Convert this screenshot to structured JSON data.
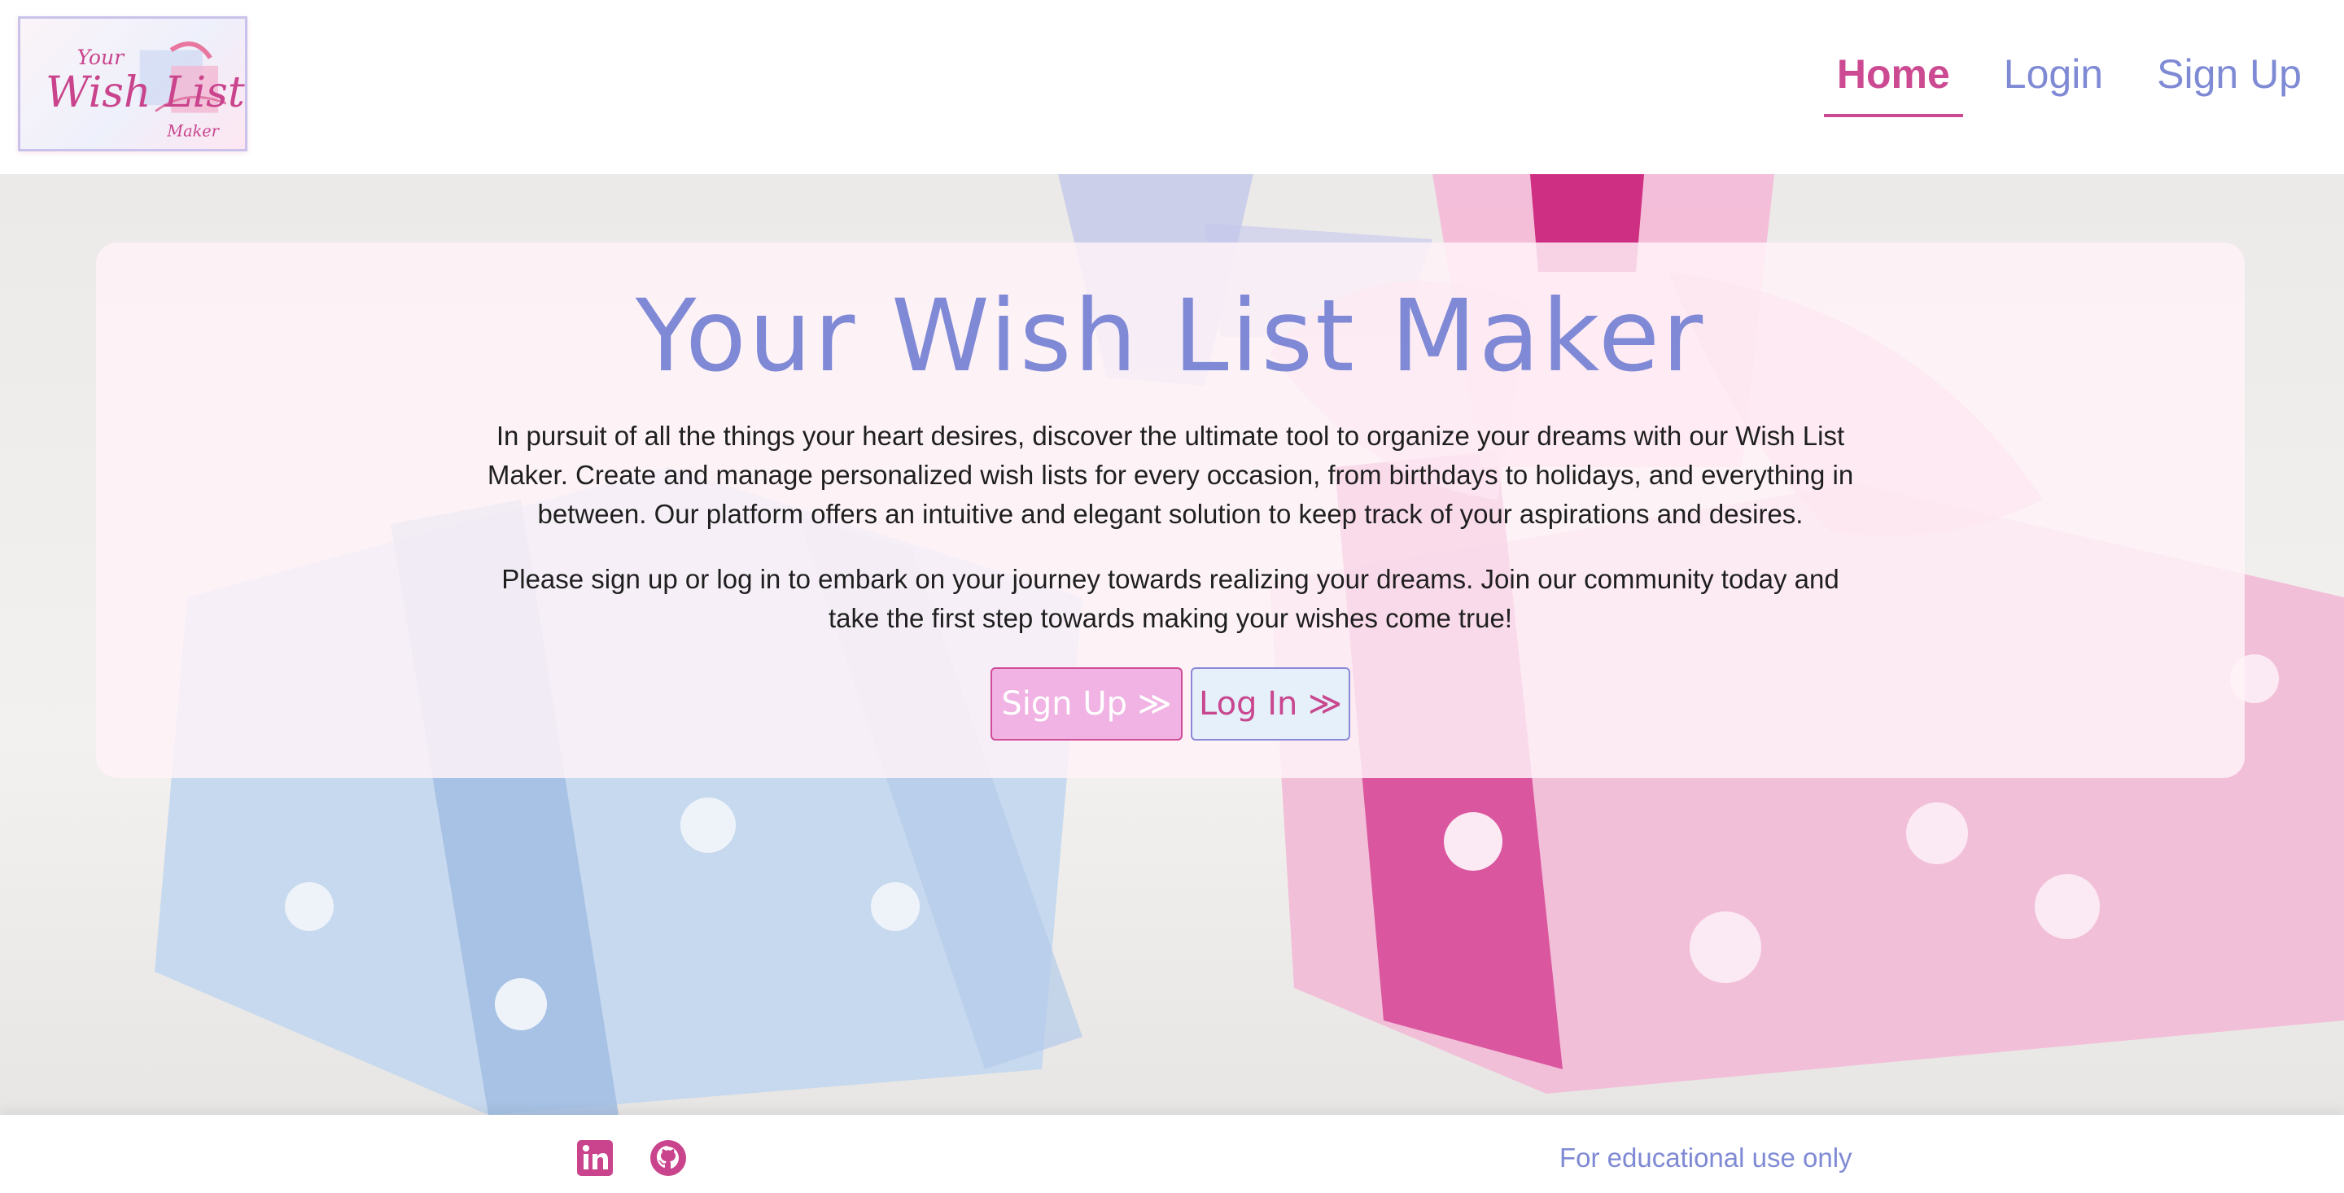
{
  "logo": {
    "line1": "Your",
    "line2": "Wish List",
    "line3": "Maker"
  },
  "nav": {
    "items": [
      {
        "label": "Home",
        "active": true
      },
      {
        "label": "Login",
        "active": false
      },
      {
        "label": "Sign Up",
        "active": false
      }
    ]
  },
  "hero": {
    "title": "Your Wish List Maker",
    "paragraph1": "In pursuit of all the things your heart desires, discover the ultimate tool to organize your dreams with our Wish List Maker. Create and manage personalized wish lists for every occasion, from birthdays to holidays, and everything in between. Our platform offers an intuitive and elegant solution to keep track of your aspirations and desires.",
    "paragraph2": "Please sign up or log in to embark on your journey towards realizing your dreams. Join our community today and take the first step towards making your wishes come true!",
    "signup_button": "Sign Up ≫",
    "login_button": "Log In ≫"
  },
  "footer": {
    "linkedin_icon": "linkedin-icon",
    "github_icon": "github-icon",
    "note": "For educational use only"
  },
  "colors": {
    "accent_pink": "#cc4a92",
    "accent_blue": "#7f8ad4"
  }
}
